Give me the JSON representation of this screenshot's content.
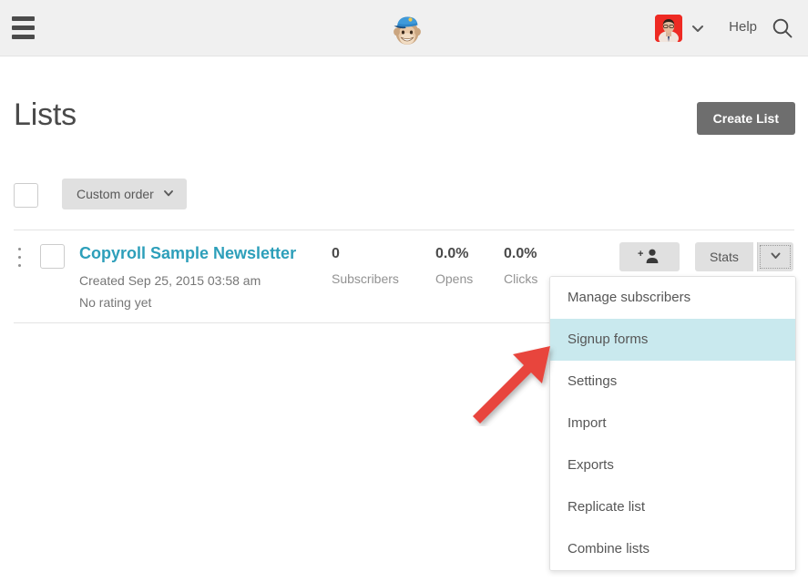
{
  "header": {
    "menu_icon": "hamburger-menu-icon",
    "logo_icon": "mailchimp-freddie-logo",
    "avatar_icon": "user-avatar",
    "user_caret_icon": "chevron-down-icon",
    "help_label": "Help",
    "search_icon": "search-icon",
    "background_color": "#f0f0f0"
  },
  "page": {
    "title": "Lists",
    "create_button_label": "Create List",
    "create_button_color": "#6e6e6e"
  },
  "toolbar": {
    "select_all_checkbox": "",
    "order_label": "Custom order",
    "order_caret_icon": "chevron-down-icon"
  },
  "list_row": {
    "grip_icon": "drag-handle-icon",
    "row_checkbox": "",
    "name": "Copyroll Sample Newsletter",
    "name_color": "#2d9fba",
    "created": "Created Sep 25, 2015 03:58 am",
    "rating": "No rating yet",
    "stats": [
      {
        "value": "0",
        "label": "Subscribers"
      },
      {
        "value": "0.0%",
        "label": "Opens"
      },
      {
        "value": "0.0%",
        "label": "Clicks"
      }
    ],
    "add_subscriber_icon": "add-person-icon",
    "stats_button_label": "Stats",
    "caret_icon": "chevron-down-icon"
  },
  "dropdown": {
    "highlight_color": "#c9e9ee",
    "active_index": 1,
    "items": [
      {
        "label": "Manage subscribers"
      },
      {
        "label": "Signup forms"
      },
      {
        "label": "Settings"
      },
      {
        "label": "Import"
      },
      {
        "label": "Exports"
      },
      {
        "label": "Replicate list"
      },
      {
        "label": "Combine lists"
      }
    ]
  },
  "annotation": {
    "arrow_icon": "red-pointer-arrow",
    "arrow_color": "#e8453c",
    "points_to": "Signup forms"
  }
}
